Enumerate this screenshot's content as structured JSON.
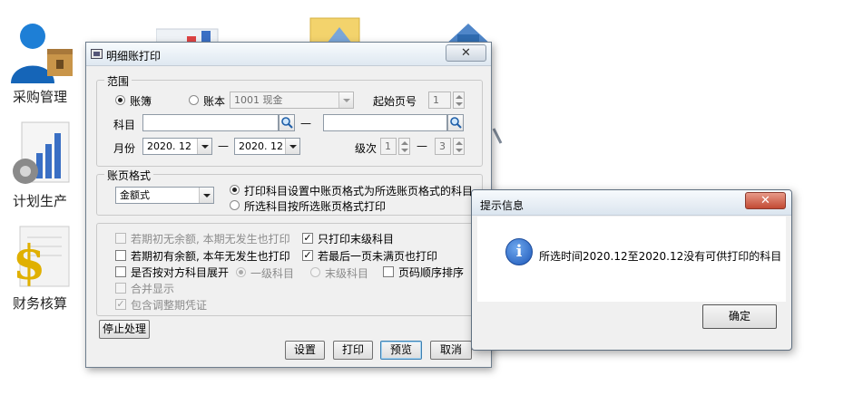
{
  "desktop": {
    "icons": [
      {
        "label": "采购管理",
        "icon": "purchase-manager-icon"
      },
      {
        "label": "计划生产",
        "icon": "production-plan-icon"
      },
      {
        "label": "财务核算",
        "icon": "finance-accounting-icon"
      }
    ]
  },
  "dialog": {
    "title": "明细账打印",
    "range": {
      "legend": "范围",
      "radio_ledger": "账簿",
      "radio_account_book": "账本",
      "account_book_value": "1001  现金",
      "start_page_label": "起始页号",
      "start_page_value": "1",
      "subject_label": "科目",
      "subject_from": "",
      "subject_to": "",
      "dash": "—",
      "month_label": "月份",
      "month_from": "2020. 12",
      "month_to": "2020. 12",
      "level_label": "级次",
      "level_from": "1",
      "level_to": "3"
    },
    "format": {
      "legend": "账页格式",
      "format_value": "金额式",
      "option_print_subject_setting": "打印科目设置中账页格式为所选账页格式的科目",
      "option_print_by_selected": "所选科目按所选账页格式打印"
    },
    "options": {
      "no_balance_no_entry": "若期初无余额, 本期无发生也打印",
      "has_balance_no_entry": "若期初有余额, 本年无发生也打印",
      "expand_by_counter": "是否按对方科目展开",
      "level_one": "一级科目",
      "last_level": "末级科目",
      "merge_display": "合并显示",
      "include_adjust": "包含调整期凭证",
      "print_last_level_only": "只打印末级科目",
      "print_last_page": "若最后一页未满页也打印",
      "page_order": "页码顺序排序"
    },
    "buttons": {
      "stop": "停止处理",
      "setup": "设置",
      "print": "打印",
      "preview": "预览",
      "cancel": "取消"
    }
  },
  "message_box": {
    "title": "提示信息",
    "text": "所选时间2020.12至2020.12没有可供打印的科目",
    "ok": "确定",
    "close_glyph": "✕"
  }
}
